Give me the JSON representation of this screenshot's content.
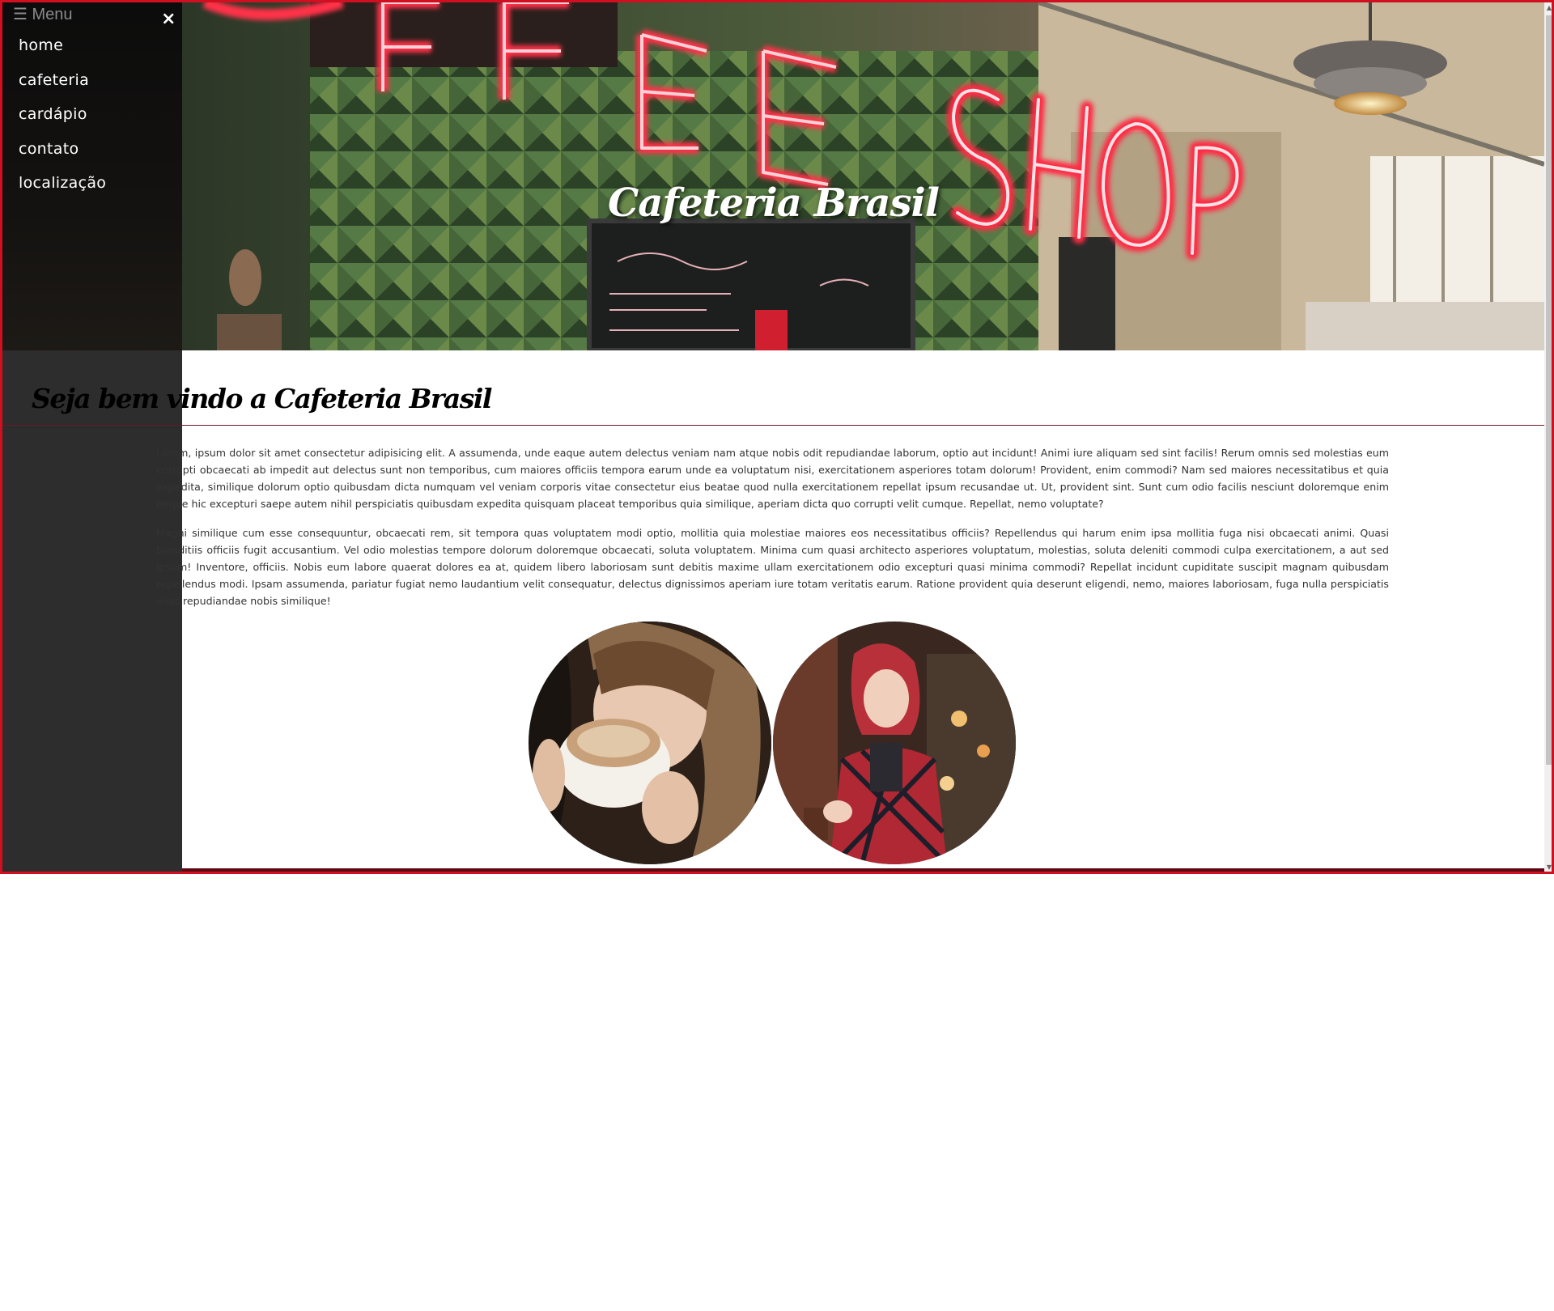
{
  "menu": {
    "label": "☰ Menu",
    "close": "×",
    "items": [
      {
        "label": "home"
      },
      {
        "label": "cafeteria"
      },
      {
        "label": "cardápio"
      },
      {
        "label": "contato"
      },
      {
        "label": "localização"
      }
    ]
  },
  "hero": {
    "title": "Cafeteria Brasil"
  },
  "main": {
    "heading": "Seja bem vindo a Cafeteria Brasil",
    "paragraphs": [
      "Lorem, ipsum dolor sit amet consectetur adipisicing elit. A assumenda, unde eaque autem delectus veniam nam atque nobis odit repudiandae laborum, optio aut incidunt! Animi iure aliquam sed sint facilis! Rerum omnis sed molestias eum corrupti obcaecati ab impedit aut delectus sunt non temporibus, cum maiores officiis tempora earum unde ea voluptatum nisi, exercitationem asperiores totam dolorum! Provident, enim commodi? Nam sed maiores necessitatibus et quia expedita, similique dolorum optio quibusdam dicta numquam vel veniam corporis vitae consectetur eius beatae quod nulla exercitationem repellat ipsum recusandae ut. Ut, provident sint. Sunt cum odio facilis nesciunt doloremque enim neque hic excepturi saepe autem nihil perspiciatis quibusdam expedita quisquam placeat temporibus quia similique, aperiam dicta quo corrupti velit cumque. Repellat, nemo voluptate?",
      "Magni similique cum esse consequuntur, obcaecati rem, sit tempora quas voluptatem modi optio, mollitia quia molestiae maiores eos necessitatibus officiis? Repellendus qui harum enim ipsa mollitia fuga nisi obcaecati animi. Quasi blanditiis officiis fugit accusantium. Vel odio molestias tempore dolorum doloremque obcaecati, soluta voluptatem. Minima cum quasi architecto asperiores voluptatum, molestias, soluta deleniti commodi culpa exercitationem, a aut sed ipsum! Inventore, officiis. Nobis eum labore quaerat dolores ea at, quidem libero laboriosam sunt debitis maxime ullam exercitationem odio excepturi quasi minima commodi? Repellat incidunt cupiditate suscipit magnam quibusdam repellendus modi. Ipsam assumenda, pariatur fugiat nemo laudantium velit consequatur, delectus dignissimos aperiam iure totam veritatis earum. Ratione provident quia deserunt eligendi, nemo, maiores laboriosam, fuga nulla perspiciatis alias repudiandae nobis similique!"
    ]
  },
  "colors": {
    "frame_border": "#d01020",
    "sidebar_bg": "#2d2d2d",
    "neon_red": "#e8203a",
    "divider": "#6a1a24"
  },
  "icons": [
    "menu-icon",
    "close-icon"
  ]
}
